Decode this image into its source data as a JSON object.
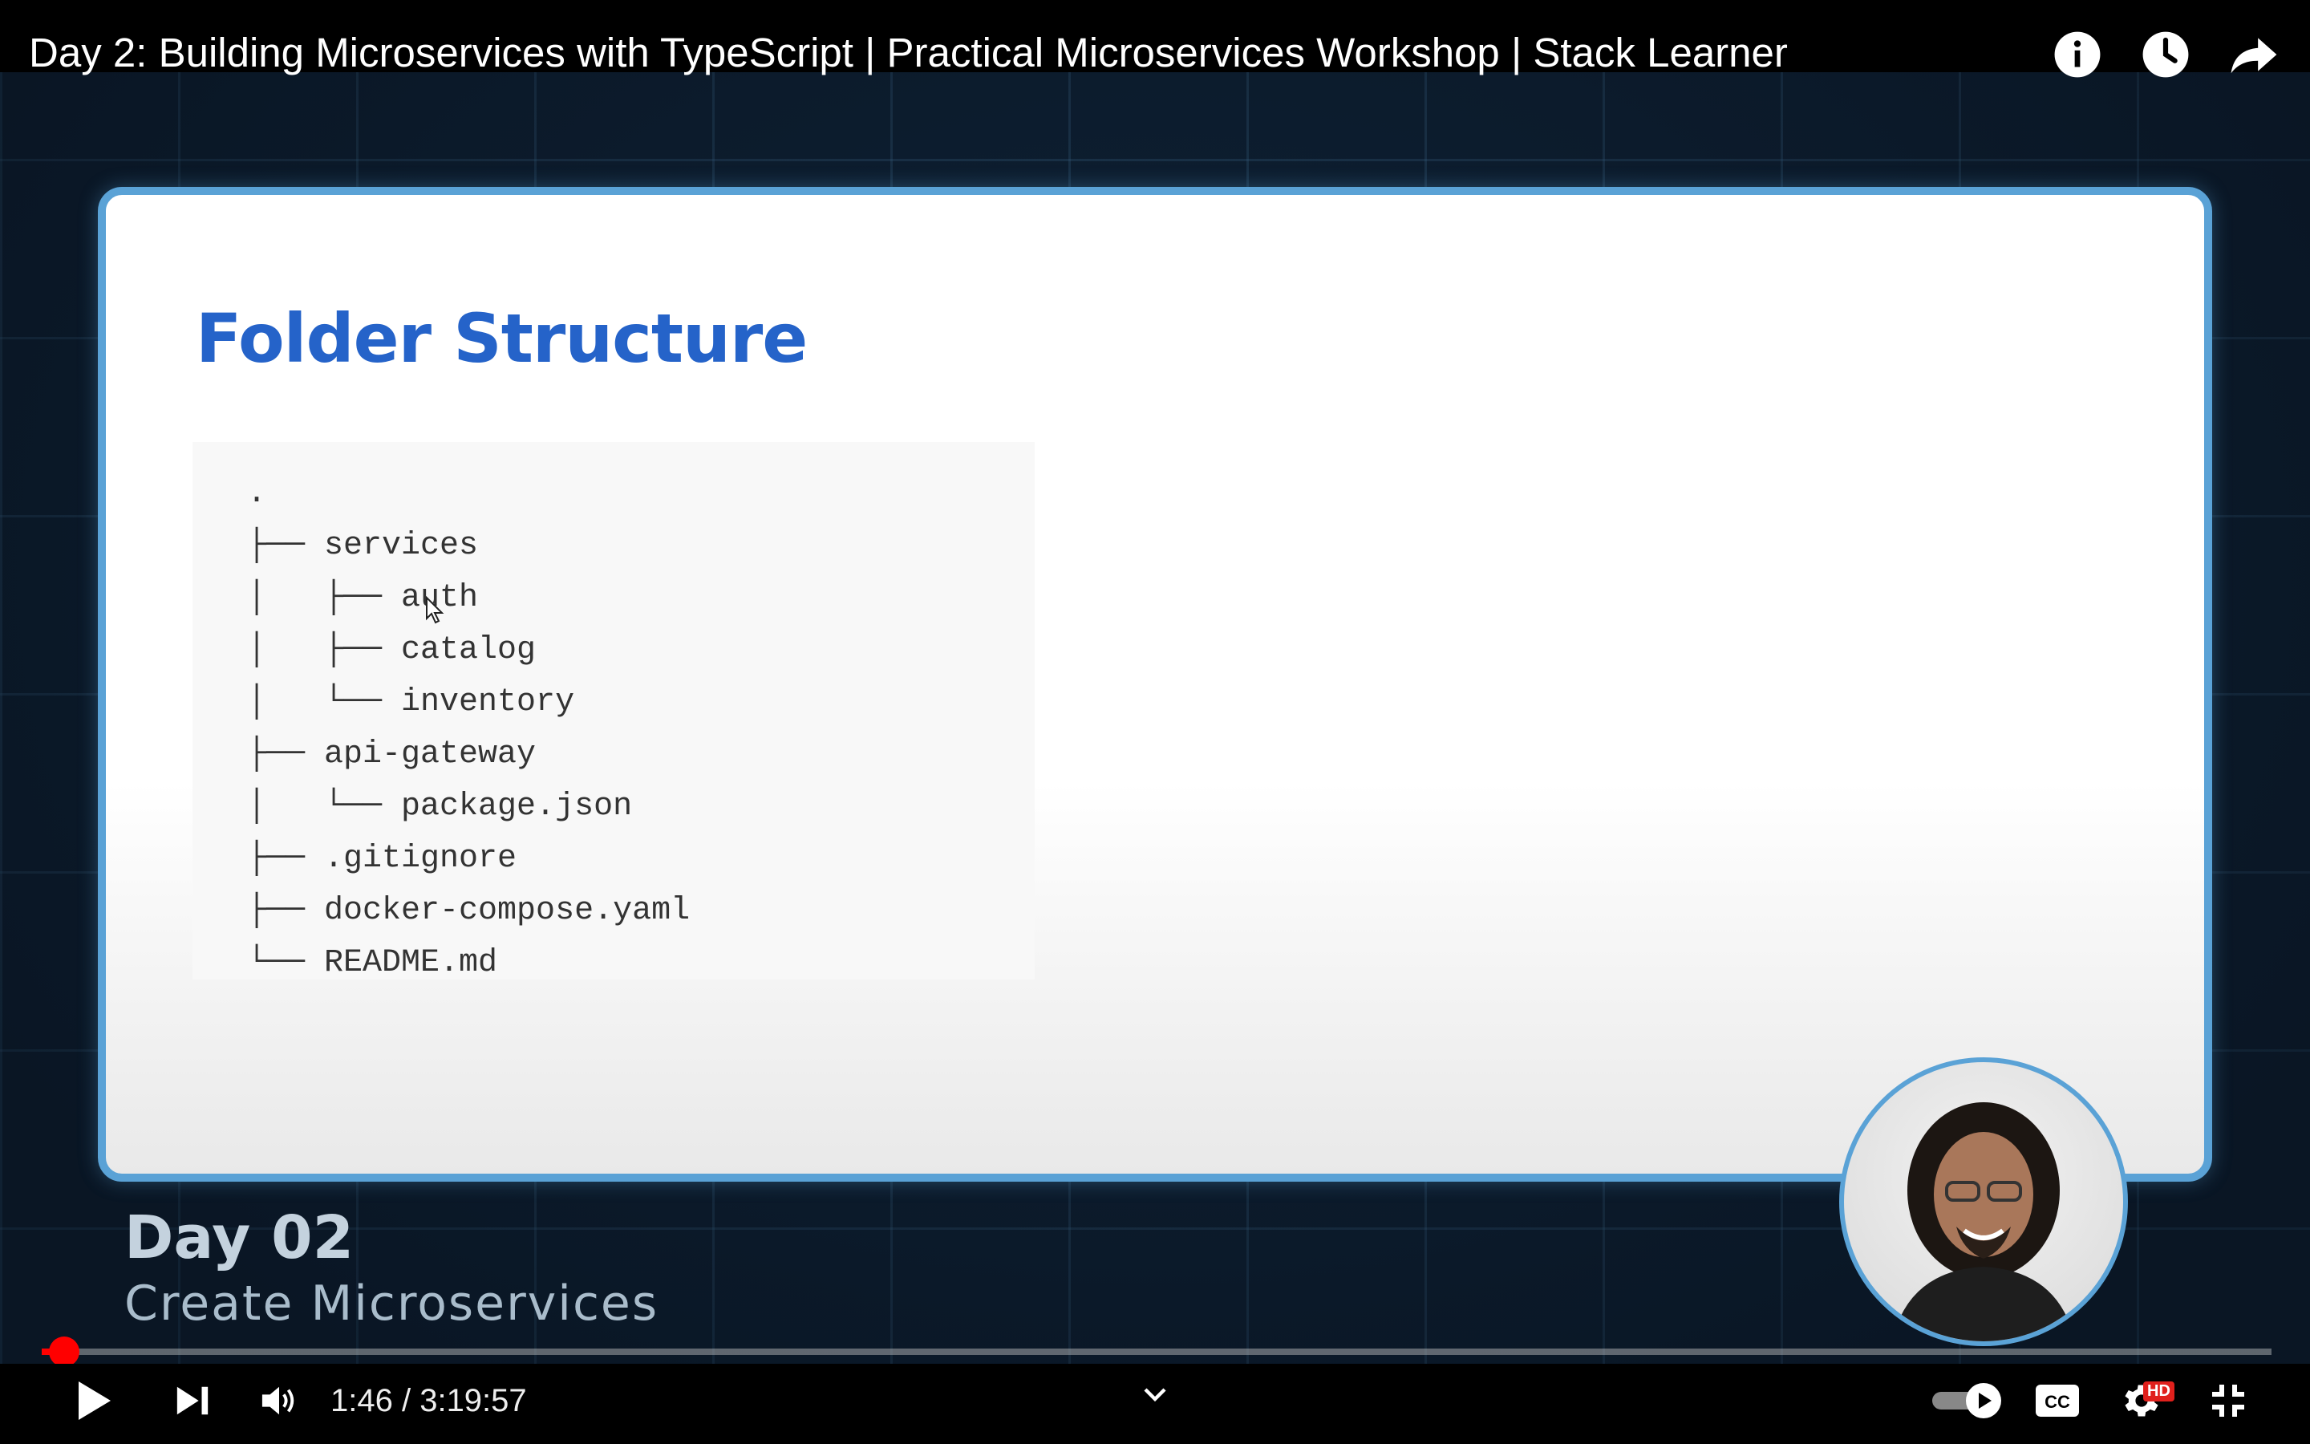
{
  "video": {
    "title": "Day 2: Building Microservices with TypeScript | Practical Microservices Workshop | Stack Learner"
  },
  "top_icons": [
    "info-icon",
    "watch-later-icon",
    "share-icon"
  ],
  "slide": {
    "title": "Folder Structure",
    "tree_lines": [
      ".",
      "├── services",
      "│   ├── auth",
      "│   ├── catalog",
      "│   └── inventory",
      "├── api-gateway",
      "│   └── package.json",
      "├── .gitignore",
      "├── docker-compose.yaml",
      "└── README.md"
    ],
    "title_color": "#2563c9",
    "border_color": "#5aa2d6"
  },
  "lower_third": {
    "day": "Day 02",
    "subtitle": "Create Microservices"
  },
  "player": {
    "current_time": "1:46",
    "separator": " / ",
    "duration": "3:19:57",
    "progress_fraction": 0.0046,
    "quality_badge": "HD",
    "progress_color": "#ff0000",
    "controls": [
      "play-icon",
      "next-icon",
      "volume-icon",
      "chevron-down-icon",
      "autoplay-toggle",
      "captions-icon",
      "settings-icon",
      "exit-fullscreen-icon"
    ]
  }
}
